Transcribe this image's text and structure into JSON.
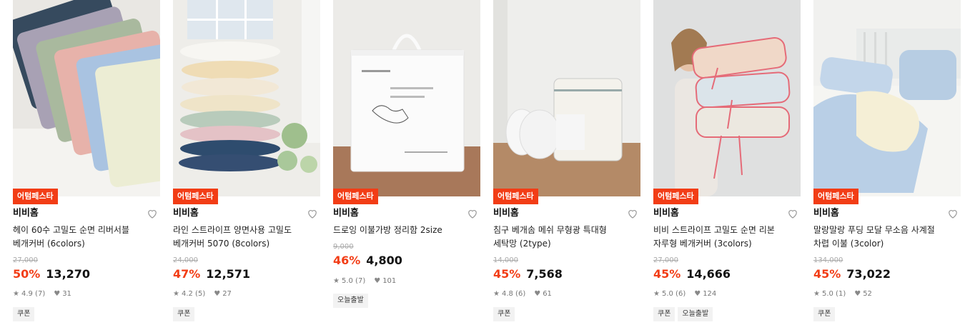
{
  "products": [
    {
      "badge": "어텀페스타",
      "brand": "비비홈",
      "title": "헤이 60수 고밀도 순면 리버서블\n베개커버 (6colors)",
      "original_price": "27,000",
      "discount": "50%",
      "price": "13,270",
      "rating": "4.9 (7)",
      "likes": "31",
      "tags": [
        "쿠폰"
      ]
    },
    {
      "badge": "어텀페스타",
      "brand": "비비홈",
      "title": "라인 스트라이프 양면사용 고밀도\n베개커버 5070 (8colors)",
      "original_price": "24,000",
      "discount": "47%",
      "price": "12,571",
      "rating": "4.2 (5)",
      "likes": "27",
      "tags": [
        "쿠폰"
      ]
    },
    {
      "badge": "어텀페스타",
      "brand": "비비홈",
      "title": "드로잉 이불가방 정리함 2size",
      "original_price": "9,000",
      "discount": "46%",
      "price": "4,800",
      "rating": "5.0 (7)",
      "likes": "101",
      "tags": [
        "오늘출발"
      ]
    },
    {
      "badge": "어텀페스타",
      "brand": "비비홈",
      "title": "침구 베개솜 메쉬 무형광 특대형\n세탁망 (2type)",
      "original_price": "14,000",
      "discount": "45%",
      "price": "7,568",
      "rating": "4.8 (6)",
      "likes": "61",
      "tags": [
        "쿠폰"
      ]
    },
    {
      "badge": "어텀페스타",
      "brand": "비비홈",
      "title": "비비 스트라이프 고밀도 순면 리본\n자루형 베개커버 (3colors)",
      "original_price": "27,000",
      "discount": "45%",
      "price": "14,666",
      "rating": "5.0 (6)",
      "likes": "124",
      "tags": [
        "쿠폰",
        "오늘출발"
      ]
    },
    {
      "badge": "어텀페스타",
      "brand": "비비홈",
      "title": "말랑말랑 푸딩 모달 무소음 사계절\n차렵 이불 (3color)",
      "original_price": "134,000",
      "discount": "45%",
      "price": "73,022",
      "rating": "5.0 (1)",
      "likes": "52",
      "tags": [
        "쿠폰"
      ]
    }
  ],
  "colors": {
    "accent": "#f23d16",
    "tag_bg": "#f2f2f2"
  },
  "icons": {
    "rating": "star-icon",
    "likes": "heart-small-icon",
    "wishlist": "heart-outline-icon"
  }
}
